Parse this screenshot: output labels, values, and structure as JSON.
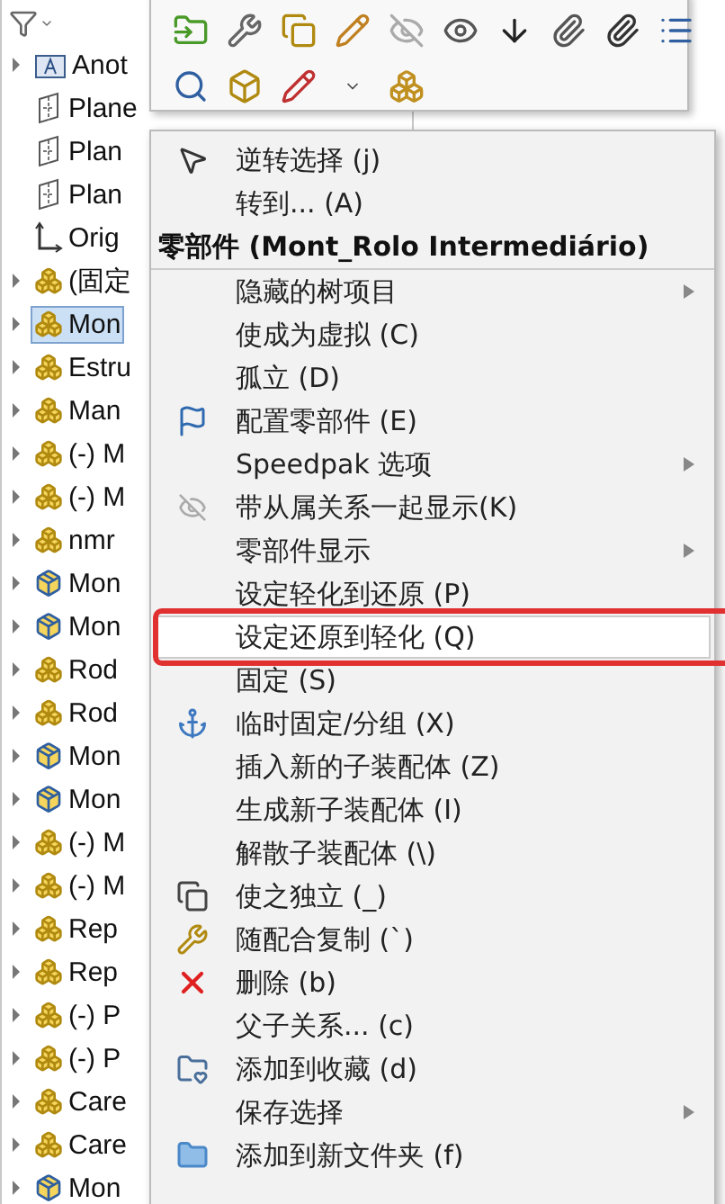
{
  "tree": {
    "items": [
      {
        "label": "Anot",
        "kind": "annotation",
        "selected": false
      },
      {
        "label": "Plane",
        "kind": "plane",
        "selected": false
      },
      {
        "label": "Plan",
        "kind": "plane",
        "selected": false
      },
      {
        "label": "Plan",
        "kind": "plane",
        "selected": false
      },
      {
        "label": "Orig",
        "kind": "origin",
        "selected": false
      },
      {
        "label": "(固定",
        "kind": "component",
        "selected": false
      },
      {
        "label": "Mon",
        "kind": "component",
        "selected": true
      },
      {
        "label": "Estru",
        "kind": "component",
        "selected": false
      },
      {
        "label": "Man",
        "kind": "component",
        "selected": false
      },
      {
        "label": "(-) M",
        "kind": "component",
        "selected": false
      },
      {
        "label": "(-) M",
        "kind": "component",
        "selected": false
      },
      {
        "label": "nmr",
        "kind": "component",
        "selected": false
      },
      {
        "label": "Mon",
        "kind": "assembly",
        "selected": false
      },
      {
        "label": "Mon",
        "kind": "assembly",
        "selected": false
      },
      {
        "label": "Rod",
        "kind": "component",
        "selected": false
      },
      {
        "label": "Rod",
        "kind": "component",
        "selected": false
      },
      {
        "label": "Mon",
        "kind": "assembly",
        "selected": false
      },
      {
        "label": "Mon",
        "kind": "assembly",
        "selected": false
      },
      {
        "label": "(-) M",
        "kind": "component",
        "selected": false
      },
      {
        "label": "(-) M",
        "kind": "component",
        "selected": false
      },
      {
        "label": "Rep",
        "kind": "component",
        "selected": false
      },
      {
        "label": "Rep",
        "kind": "component",
        "selected": false
      },
      {
        "label": "(-) P",
        "kind": "component",
        "selected": false
      },
      {
        "label": "(-) P",
        "kind": "component",
        "selected": false
      },
      {
        "label": "Care",
        "kind": "component",
        "selected": false
      },
      {
        "label": "Care",
        "kind": "component",
        "selected": false
      },
      {
        "label": "Mon",
        "kind": "assembly",
        "selected": false
      }
    ]
  },
  "context_menu": {
    "items": [
      {
        "kind": "item",
        "label": "逆转选择 (j)",
        "submenu": false,
        "selected": false
      },
      {
        "kind": "item",
        "label": "转到... (A)",
        "submenu": false,
        "selected": false
      },
      {
        "kind": "header",
        "label": "零部件 (Mont_Rolo Intermediário)"
      },
      {
        "kind": "item",
        "label": "隐藏的树项目",
        "submenu": true,
        "selected": false
      },
      {
        "kind": "item",
        "label": "使成为虚拟 (C)",
        "submenu": false,
        "selected": false
      },
      {
        "kind": "item",
        "label": "孤立 (D)",
        "submenu": false,
        "selected": false
      },
      {
        "kind": "item",
        "label": "配置零部件 (E)",
        "submenu": false,
        "selected": false
      },
      {
        "kind": "item",
        "label": "Speedpak 选项",
        "submenu": true,
        "selected": false
      },
      {
        "kind": "item",
        "label": "带从属关系一起显示(K)",
        "submenu": false,
        "selected": false
      },
      {
        "kind": "item",
        "label": "零部件显示",
        "submenu": true,
        "selected": false
      },
      {
        "kind": "item",
        "label": "设定轻化到还原 (P)",
        "submenu": false,
        "selected": false
      },
      {
        "kind": "item",
        "label": "设定还原到轻化 (Q)",
        "submenu": false,
        "selected": true
      },
      {
        "kind": "item",
        "label": "固定 (S)",
        "submenu": false,
        "selected": false
      },
      {
        "kind": "item",
        "label": "临时固定/分组 (X)",
        "submenu": false,
        "selected": false
      },
      {
        "kind": "item",
        "label": "插入新的子装配体 (Z)",
        "submenu": false,
        "selected": false
      },
      {
        "kind": "item",
        "label": "生成新子装配体 (I)",
        "submenu": false,
        "selected": false
      },
      {
        "kind": "item",
        "label": "解散子装配体 (\\)",
        "submenu": false,
        "selected": false
      },
      {
        "kind": "item",
        "label": "使之独立 (_)",
        "submenu": false,
        "selected": false
      },
      {
        "kind": "item",
        "label": "随配合复制 (`)",
        "submenu": false,
        "selected": false
      },
      {
        "kind": "item",
        "label": "删除 (b)",
        "submenu": false,
        "selected": false
      },
      {
        "kind": "item",
        "label": "父子关系... (c)",
        "submenu": false,
        "selected": false
      },
      {
        "kind": "item",
        "label": "添加到收藏 (d)",
        "submenu": false,
        "selected": false
      },
      {
        "kind": "item",
        "label": "保存选择",
        "submenu": true,
        "selected": false
      },
      {
        "kind": "item",
        "label": "添加到新文件夹 (f)",
        "submenu": false,
        "selected": false
      }
    ]
  }
}
